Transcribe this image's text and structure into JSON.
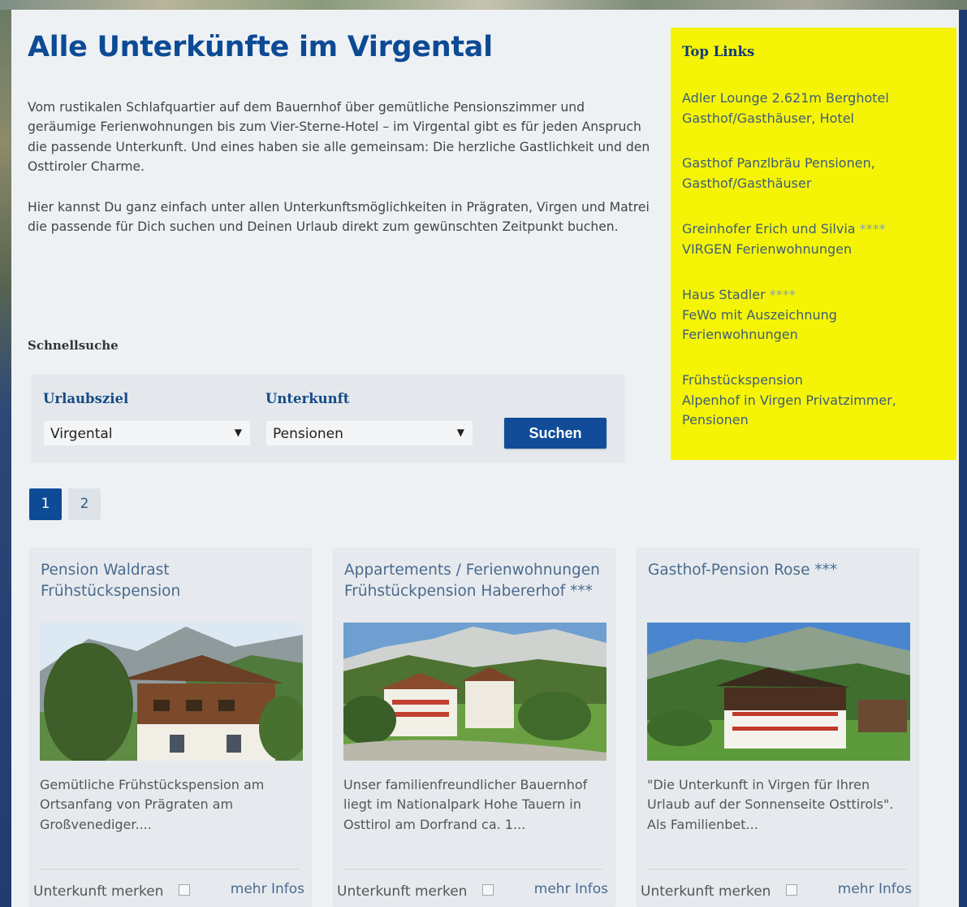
{
  "page": {
    "title": "Alle Unterkünfte im Virgental",
    "intro1": "Vom rustikalen Schlafquartier auf dem Bauernhof über gemütliche Pensionszimmer und geräumige Ferienwohnungen bis zum Vier-Sterne-Hotel – im Virgental gibt es für jeden Anspruch die passende Unterkunft. Und eines haben sie alle gemeinsam: Die herzliche Gastlichkeit und den Osttiroler Charme.",
    "intro2": "Hier kannst Du ganz einfach unter allen Unterkunftsmöglichkeiten in Prägraten, Virgen und Matrei die passende für Dich suchen und Deinen Urlaub direkt zum gewünschten Zeitpunkt buchen."
  },
  "search": {
    "heading": "Schnellsuche",
    "destination_label": "Urlaubsziel",
    "destination_value": "Virgental",
    "type_label": "Unterkunft",
    "type_value": "Pensionen",
    "button_label": "Suchen",
    "dropdown_arrow": "▼"
  },
  "pagination": {
    "pages": [
      "1",
      "2"
    ],
    "active": "1"
  },
  "sidebar": {
    "title": "Top Links",
    "links": [
      {
        "line1": "Adler Lounge 2.621m Berghotel",
        "line2": "Gasthof/Gasthäuser, Hotel",
        "line3": ""
      },
      {
        "line1": "Gasthof Panzlbräu Pensionen,",
        "line2": "Gasthof/Gasthäuser",
        "line3": ""
      },
      {
        "line1": "Greinhofer Erich und Silvia",
        "stars": "****",
        "line2": "VIRGEN Ferienwohnungen",
        "line3": ""
      },
      {
        "line1": "Haus Stadler",
        "stars": "****",
        "line2": "FeWo mit Auszeichnung",
        "line3": "Ferienwohnungen"
      },
      {
        "line1": "Frühstückspension",
        "line2": "Alpenhof in Virgen Privatzimmer,",
        "line3": "Pensionen"
      }
    ]
  },
  "cards": [
    {
      "title_line1": "Pension Waldrast",
      "title_line2": "Frühstückspension",
      "description": "Gemütliche Frühstückspension am Ortsanfang von Prägraten am Großvenediger....",
      "remember_label": "Unterkunft merken",
      "more_label": "mehr Infos"
    },
    {
      "title_line1": "Appartements / Ferienwohnungen",
      "title_line2": "Frühstückpension Habererhof ***",
      "description": "Unser familienfreundlicher Bauernhof liegt im Nationalpark Hohe Tauern in Osttirol am Dorfrand ca. 1...",
      "remember_label": "Unterkunft merken",
      "more_label": "mehr Infos"
    },
    {
      "title_line1": "Gasthof-Pension Rose ***",
      "title_line2": "",
      "description": "\"Die Unterkunft in Virgen für Ihren Urlaub auf der Sonnenseite Osttirols\". Als Familienbet...",
      "remember_label": "Unterkunft merken",
      "more_label": "mehr Infos"
    }
  ],
  "colors": {
    "brand_blue": "#0c4a94",
    "sidebar_yellow": "#f5f406",
    "link_blue": "#4a6a8e"
  }
}
